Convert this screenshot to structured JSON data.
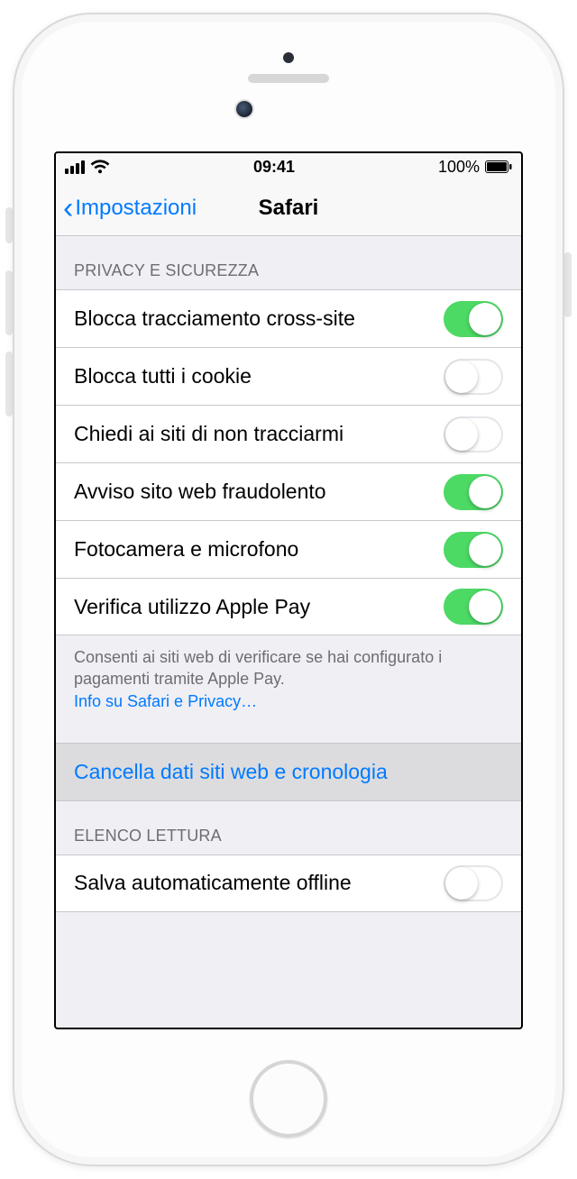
{
  "status": {
    "time": "09:41",
    "battery_text": "100%"
  },
  "nav": {
    "back_label": "Impostazioni",
    "title": "Safari"
  },
  "section_privacy": {
    "header": "PRIVACY E SICUREZZA",
    "rows": [
      {
        "label": "Blocca tracciamento cross-site",
        "on": true
      },
      {
        "label": "Blocca tutti i cookie",
        "on": false
      },
      {
        "label": "Chiedi ai siti di non tracciarmi",
        "on": false
      },
      {
        "label": "Avviso sito web fraudolento",
        "on": true
      },
      {
        "label": "Fotocamera e microfono",
        "on": true
      },
      {
        "label": "Verifica utilizzo Apple Pay",
        "on": true
      }
    ],
    "footer_text": "Consenti ai siti web di verificare se hai configurato i pagamenti tramite Apple Pay.",
    "footer_link": "Info su Safari e Privacy…"
  },
  "clear_action": "Cancella dati siti web e cronologia",
  "section_readinglist": {
    "header": "ELENCO LETTURA",
    "rows": [
      {
        "label": "Salva automaticamente offline",
        "on": false
      }
    ]
  }
}
